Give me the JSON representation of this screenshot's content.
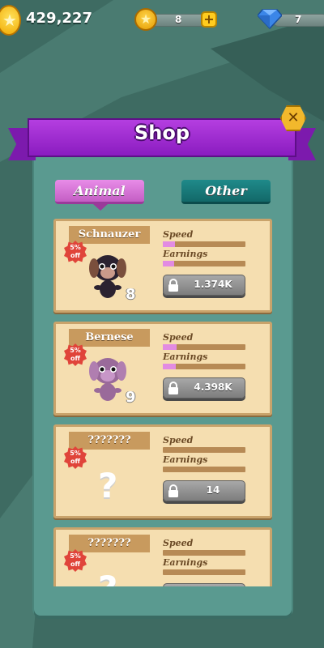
{
  "hud": {
    "coins": "429,227",
    "stars": "8",
    "gems": "7",
    "icons": [
      "coin-icon",
      "star-icon",
      "plus-icon",
      "gem-icon"
    ]
  },
  "shop": {
    "title": "Shop",
    "close_icon": "close-icon",
    "tabs": [
      {
        "label": "Animal",
        "selected": true
      },
      {
        "label": "Other",
        "selected": false
      }
    ]
  },
  "items": [
    {
      "name": "Schnauzer",
      "discount": "5% off",
      "level": "8",
      "speed_label": "Speed",
      "earnings_label": "Earnings",
      "speed": 0.15,
      "earnings": 0.14,
      "price": "1.374K",
      "locked": true,
      "pet_color": "#2b2230",
      "pet_ear": "#7a4f3d"
    },
    {
      "name": "Bernese",
      "discount": "5% off",
      "level": "9",
      "speed_label": "Speed",
      "earnings_label": "Earnings",
      "speed": 0.17,
      "earnings": 0.16,
      "price": "4.398K",
      "locked": true,
      "pet_color": "#9a6a9a",
      "pet_ear": "#b07eb0"
    },
    {
      "name": "???????",
      "discount": "5% off",
      "level": "",
      "speed_label": "Speed",
      "earnings_label": "Earnings",
      "speed": 0,
      "earnings": 0,
      "price": "14",
      "locked": true,
      "unknown": true
    },
    {
      "name": "???????",
      "discount": "5% off",
      "level": "",
      "speed_label": "Speed",
      "earnings_label": "Earnings",
      "speed": 0,
      "earnings": 0,
      "price": "",
      "locked": true,
      "unknown": true
    }
  ],
  "colors": {
    "banner": "#a42fd6",
    "tab_active": "#d672d6",
    "tab_other": "#177a7a",
    "card": "#f5deb0"
  }
}
